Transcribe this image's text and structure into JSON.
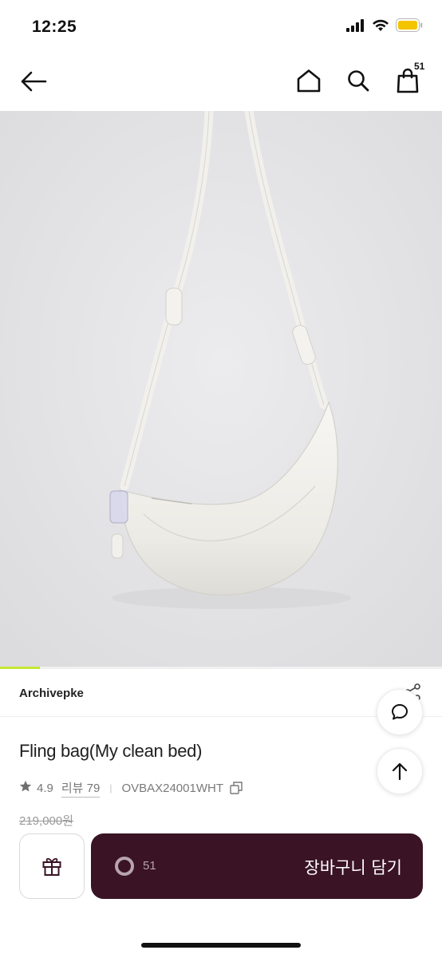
{
  "status_bar": {
    "time": "12:25",
    "icons": [
      "cellular-signal-icon",
      "wifi-icon",
      "battery-icon"
    ],
    "battery_color": "#f5c400"
  },
  "nav": {
    "icons": [
      "back-arrow-icon",
      "home-icon",
      "search-icon",
      "shopping-bag-icon"
    ],
    "cart_count": "51"
  },
  "product": {
    "image_subject": "white crescent shoulder bag",
    "image_progress": 0.09,
    "brand": "Archivepke",
    "name": "Fling bag(My clean bed)",
    "rating": "4.9",
    "review_label": "리뷰 79",
    "product_code": "OVBAX24001WHT",
    "original_price": "219,000원"
  },
  "floating": {
    "icons": [
      "chat-bubble-icon",
      "arrow-up-icon"
    ]
  },
  "bottom_bar": {
    "like_count": "51",
    "add_to_cart_label": "장바구니 담기",
    "icons": [
      "gift-icon",
      "heart-ring-icon"
    ]
  },
  "colors": {
    "accent_dark": "#3a1325",
    "progress_accent": "#c5e833",
    "image_background": "#e4e4e6"
  }
}
